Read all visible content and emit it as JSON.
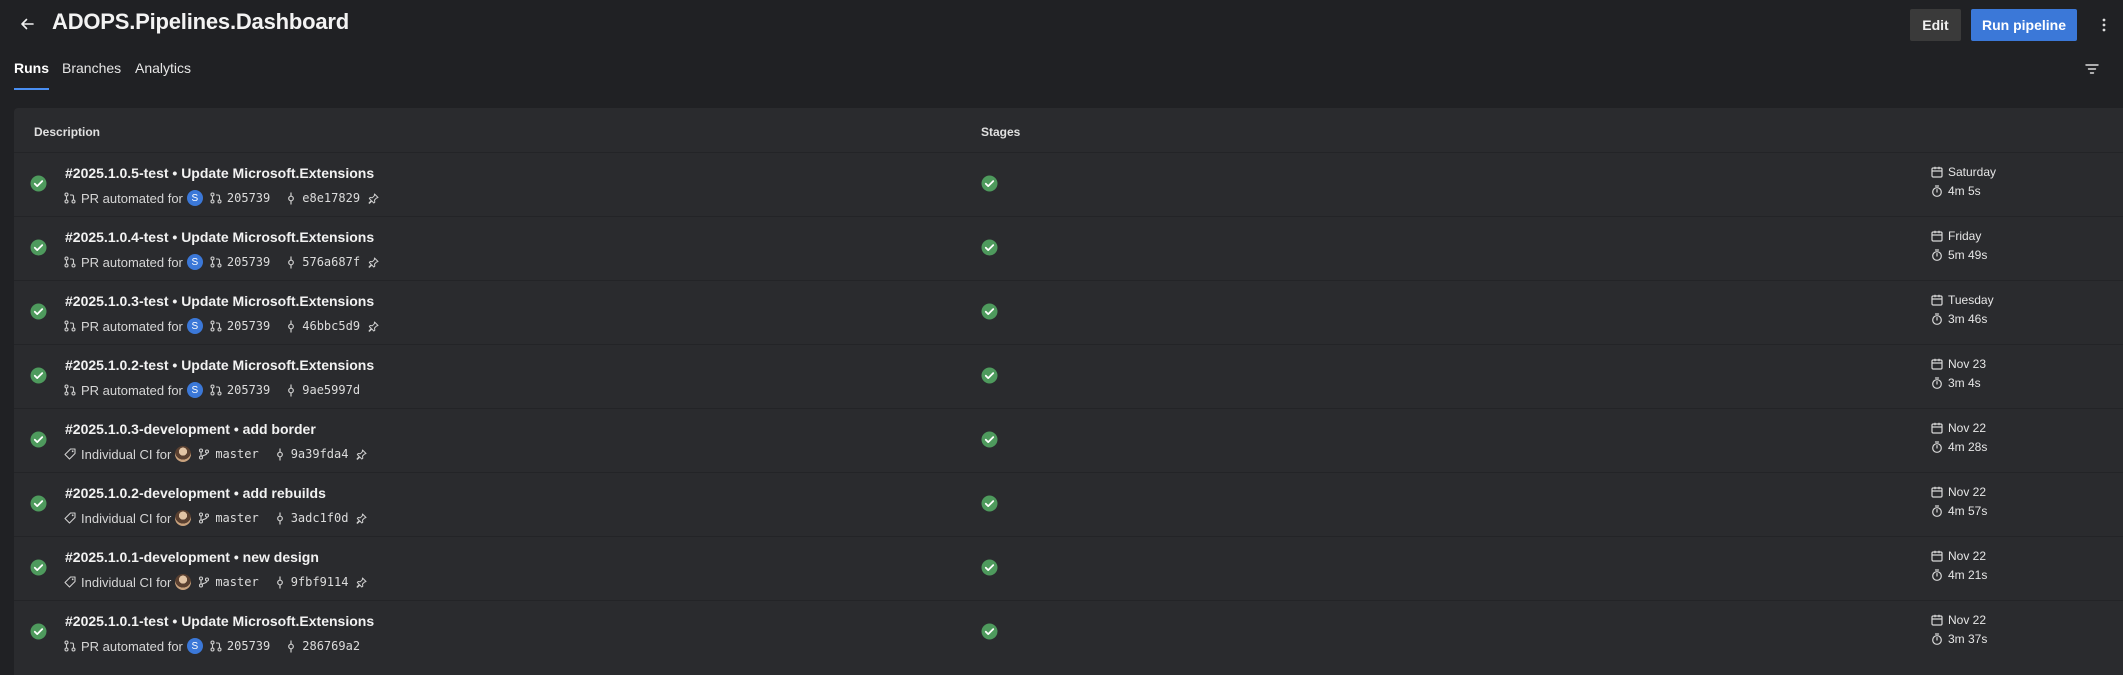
{
  "header": {
    "title": "ADOPS.Pipelines.Dashboard",
    "edit_label": "Edit",
    "run_label": "Run pipeline"
  },
  "tabs": [
    {
      "label": "Runs",
      "active": true
    },
    {
      "label": "Branches",
      "active": false
    },
    {
      "label": "Analytics",
      "active": false
    }
  ],
  "columns": {
    "description": "Description",
    "stages": "Stages"
  },
  "colors": {
    "success": "#4e9a5d",
    "accent": "#3b78d8",
    "background": "#202124",
    "panel": "#2a2b2e"
  },
  "runs": [
    {
      "title": "#2025.1.0.5-test • Update Microsoft.Extensions",
      "reason": "PR automated for",
      "avatar": "S",
      "ref": "205739",
      "ref_icon": "pull-request-icon",
      "commit": "e8e17829",
      "pinned": true,
      "when": "Saturday",
      "duration": "4m 5s",
      "status": "succeeded"
    },
    {
      "title": "#2025.1.0.4-test • Update Microsoft.Extensions",
      "reason": "PR automated for",
      "avatar": "S",
      "ref": "205739",
      "ref_icon": "pull-request-icon",
      "commit": "576a687f",
      "pinned": true,
      "when": "Friday",
      "duration": "5m 49s",
      "status": "succeeded"
    },
    {
      "title": "#2025.1.0.3-test • Update Microsoft.Extensions",
      "reason": "PR automated for",
      "avatar": "S",
      "ref": "205739",
      "ref_icon": "pull-request-icon",
      "commit": "46bbc5d9",
      "pinned": true,
      "when": "Tuesday",
      "duration": "3m 46s",
      "status": "succeeded"
    },
    {
      "title": "#2025.1.0.2-test • Update Microsoft.Extensions",
      "reason": "PR automated for",
      "avatar": "S",
      "ref": "205739",
      "ref_icon": "pull-request-icon",
      "commit": "9ae5997d",
      "pinned": false,
      "when": "Nov 23",
      "duration": "3m 4s",
      "status": "succeeded"
    },
    {
      "title": "#2025.1.0.3-development • add border",
      "reason": "Individual CI for",
      "avatar": "",
      "ref": "master",
      "ref_icon": "branch-icon",
      "commit": "9a39fda4",
      "pinned": true,
      "when": "Nov 22",
      "duration": "4m 28s",
      "status": "succeeded"
    },
    {
      "title": "#2025.1.0.2-development • add rebuilds",
      "reason": "Individual CI for",
      "avatar": "",
      "ref": "master",
      "ref_icon": "branch-icon",
      "commit": "3adc1f0d",
      "pinned": true,
      "when": "Nov 22",
      "duration": "4m 57s",
      "status": "succeeded"
    },
    {
      "title": "#2025.1.0.1-development • new design",
      "reason": "Individual CI for",
      "avatar": "",
      "ref": "master",
      "ref_icon": "branch-icon",
      "commit": "9fbf9114",
      "pinned": true,
      "when": "Nov 22",
      "duration": "4m 21s",
      "status": "succeeded"
    },
    {
      "title": "#2025.1.0.1-test • Update Microsoft.Extensions",
      "reason": "PR automated for",
      "avatar": "S",
      "ref": "205739",
      "ref_icon": "pull-request-icon",
      "commit": "286769a2",
      "pinned": false,
      "when": "Nov 22",
      "duration": "3m 37s",
      "status": "succeeded"
    }
  ]
}
